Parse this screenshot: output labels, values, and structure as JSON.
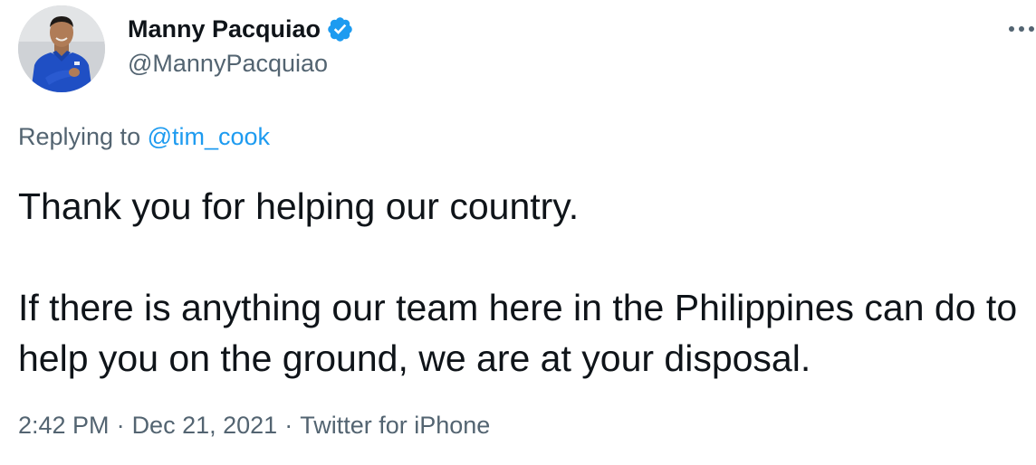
{
  "author": {
    "display_name": "Manny Pacquiao",
    "handle": "@MannyPacquiao",
    "verified": true
  },
  "reply": {
    "prefix": "Replying to ",
    "target": "@tim_cook"
  },
  "tweet": {
    "paragraphs": [
      "Thank you for helping our country.",
      "If there is anything our team here in the Philippines can do to help you on the ground, we are at your disposal."
    ]
  },
  "meta": {
    "time": "2:42 PM",
    "separator": "·",
    "date": "Dec 21, 2021",
    "source": "Twitter for iPhone"
  },
  "colors": {
    "accent": "#1d9bf0",
    "text": "#0f1419",
    "secondary": "#536471",
    "avatar_shirt": "#1f4fc4"
  },
  "icons": {
    "verified": "verified-badge-icon",
    "more": "more-options-icon"
  }
}
